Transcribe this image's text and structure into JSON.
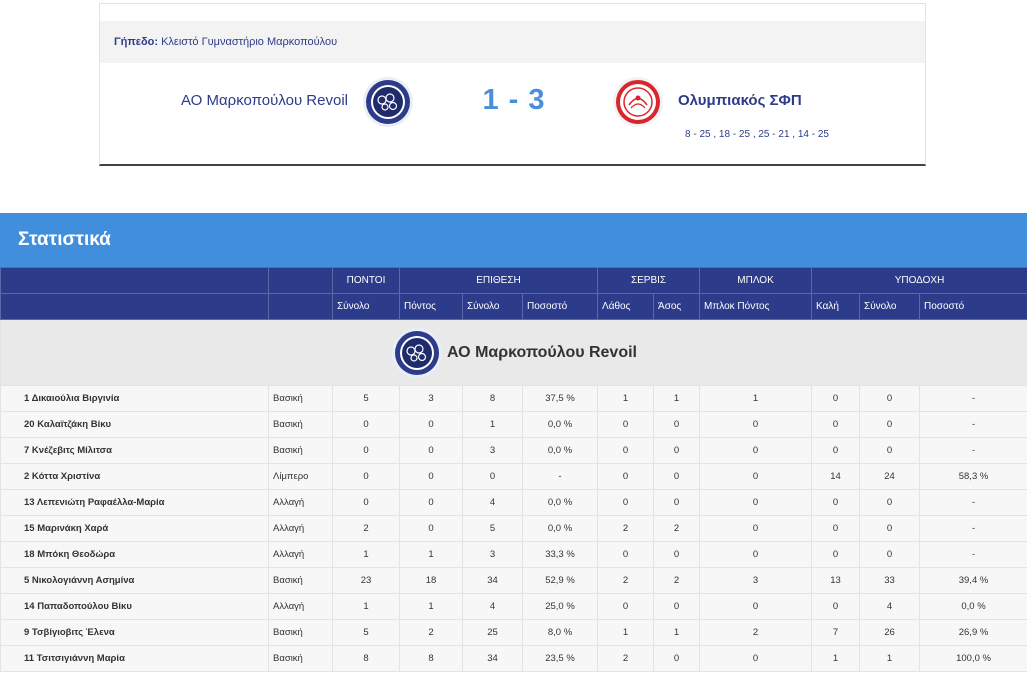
{
  "venue": {
    "label": "Γήπεδο:",
    "value": "Κλειστό Γυμναστήριο Μαρκοπούλου"
  },
  "match": {
    "home_team": "ΑΟ Μαρκοπούλου Revoil",
    "away_team": "Ολυμπιακός ΣΦΠ",
    "score": "1 - 3",
    "sets": "8 - 25 , 18 - 25 , 25 - 21 , 14 - 25"
  },
  "stats": {
    "title": "Στατιστικά",
    "groups": [
      "ΠΟΝΤΟΙ",
      "ΕΠΙΘΕΣΗ",
      "ΣΕΡΒΙΣ",
      "ΜΠΛΟΚ",
      "ΥΠΟΔΟΧΗ"
    ],
    "subheaders": [
      "Σύνολο",
      "Πόντος",
      "Σύνολο",
      "Ποσοστό",
      "Λάθος",
      "Άσος",
      "Μπλοκ Πόντος",
      "Καλή",
      "Σύνολο",
      "Ποσοστό"
    ],
    "team_name": "ΑΟ Μαρκοπούλου Revoil",
    "rows": [
      [
        "1 Δικαιούλια Βιργινία",
        "Βασική",
        "5",
        "3",
        "8",
        "37,5 %",
        "1",
        "1",
        "1",
        "0",
        "0",
        "-"
      ],
      [
        "20 Καλαϊτζάκη Βίκυ",
        "Βασική",
        "0",
        "0",
        "1",
        "0,0 %",
        "0",
        "0",
        "0",
        "0",
        "0",
        "-"
      ],
      [
        "7 Κνέζεβιτς Μίλιτσα",
        "Βασική",
        "0",
        "0",
        "3",
        "0,0 %",
        "0",
        "0",
        "0",
        "0",
        "0",
        "-"
      ],
      [
        "2 Κόττα Χριστίνα",
        "Λίμπερο",
        "0",
        "0",
        "0",
        "-",
        "0",
        "0",
        "0",
        "14",
        "24",
        "58,3 %"
      ],
      [
        "13 Λεπενιώτη Ραφαέλλα-Μαρία",
        "Αλλαγή",
        "0",
        "0",
        "4",
        "0,0 %",
        "0",
        "0",
        "0",
        "0",
        "0",
        "-"
      ],
      [
        "15 Μαρινάκη Χαρά",
        "Αλλαγή",
        "2",
        "0",
        "5",
        "0,0 %",
        "2",
        "2",
        "0",
        "0",
        "0",
        "-"
      ],
      [
        "18 Μπόκη Θεοδώρα",
        "Αλλαγή",
        "1",
        "1",
        "3",
        "33,3 %",
        "0",
        "0",
        "0",
        "0",
        "0",
        "-"
      ],
      [
        "5 Νικολογιάννη Ασημίνα",
        "Βασική",
        "23",
        "18",
        "34",
        "52,9 %",
        "2",
        "2",
        "3",
        "13",
        "33",
        "39,4 %"
      ],
      [
        "14 Παπαδοπούλου Βίκυ",
        "Αλλαγή",
        "1",
        "1",
        "4",
        "25,0 %",
        "0",
        "0",
        "0",
        "0",
        "4",
        "0,0 %"
      ],
      [
        "9 Τσβίγιοβιτς Έλενα",
        "Βασική",
        "5",
        "2",
        "25",
        "8,0 %",
        "1",
        "1",
        "2",
        "7",
        "26",
        "26,9 %"
      ],
      [
        "11 Τσιτσιγιάννη Μαρία",
        "Βασική",
        "8",
        "8",
        "34",
        "23,5 %",
        "2",
        "0",
        "0",
        "1",
        "1",
        "100,0 %"
      ]
    ]
  },
  "colors": {
    "accent": "#418fdc",
    "header": "#2d3c8a",
    "score": "#4a8fdb",
    "away_red": "#d8262c"
  },
  "icons": {
    "home_logo": "markopoulo-crest-icon",
    "away_logo": "olympiacos-crest-icon"
  }
}
